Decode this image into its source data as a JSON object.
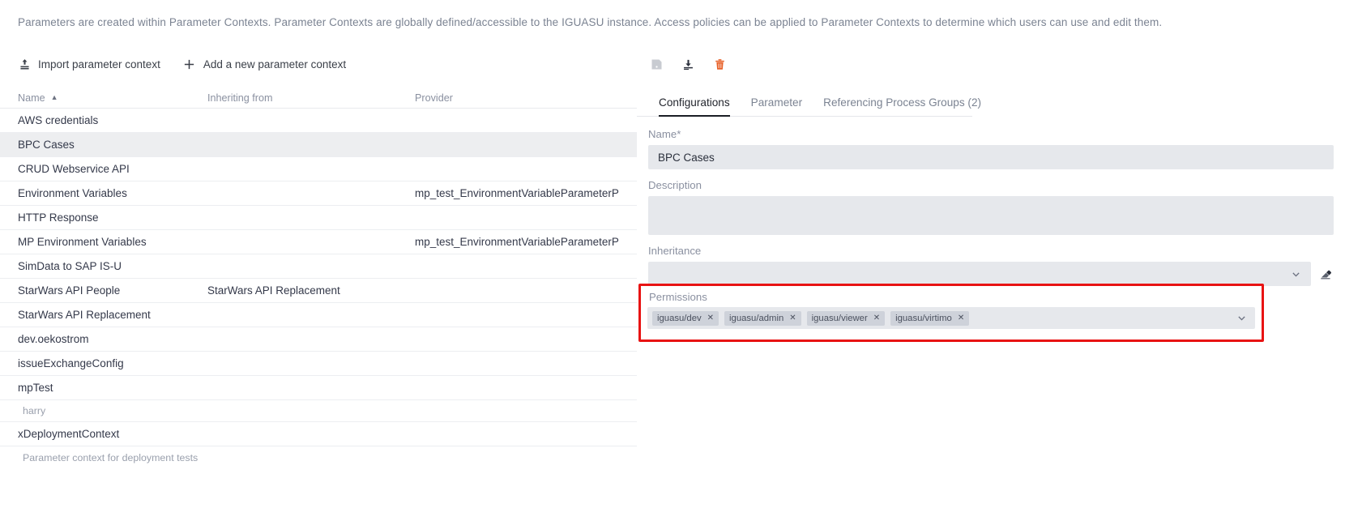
{
  "intro": {
    "text": "Parameters are created within Parameter Contexts. Parameter Contexts are globally defined/accessible to the IGUASU instance. Access policies can be applied to Parameter Contexts to determine which users can use and edit them."
  },
  "actions": {
    "import_label": "Import parameter context",
    "import_icon": "upload-icon",
    "add_label": "Add a new parameter context",
    "add_icon": "plus-icon"
  },
  "table": {
    "columns": [
      "Name",
      "Inheriting from",
      "Provider"
    ],
    "sort_column": "Name",
    "sort_direction": "asc",
    "rows": [
      {
        "name": "AWS credentials",
        "inheriting_from": "",
        "provider": "",
        "selected": false,
        "description": ""
      },
      {
        "name": "BPC Cases",
        "inheriting_from": "",
        "provider": "",
        "selected": true,
        "description": ""
      },
      {
        "name": "CRUD Webservice API",
        "inheriting_from": "",
        "provider": "",
        "selected": false,
        "description": ""
      },
      {
        "name": "Environment Variables",
        "inheriting_from": "",
        "provider": "mp_test_EnvironmentVariableParameterP",
        "selected": false,
        "description": ""
      },
      {
        "name": "HTTP Response",
        "inheriting_from": "",
        "provider": "",
        "selected": false,
        "description": ""
      },
      {
        "name": "MP Environment Variables",
        "inheriting_from": "",
        "provider": "mp_test_EnvironmentVariableParameterP",
        "selected": false,
        "description": ""
      },
      {
        "name": "SimData to SAP IS-U",
        "inheriting_from": "",
        "provider": "",
        "selected": false,
        "description": ""
      },
      {
        "name": "StarWars API People",
        "inheriting_from": "StarWars API Replacement",
        "provider": "",
        "selected": false,
        "description": ""
      },
      {
        "name": "StarWars API Replacement",
        "inheriting_from": "",
        "provider": "",
        "selected": false,
        "description": ""
      },
      {
        "name": "dev.oekostrom",
        "inheriting_from": "",
        "provider": "",
        "selected": false,
        "description": ""
      },
      {
        "name": "issueExchangeConfig",
        "inheriting_from": "",
        "provider": "",
        "selected": false,
        "description": ""
      },
      {
        "name": "mpTest",
        "inheriting_from": "",
        "provider": "",
        "selected": false,
        "description": "harry"
      },
      {
        "name": "xDeploymentContext",
        "inheriting_from": "",
        "provider": "",
        "selected": false,
        "description": "Parameter context for deployment tests"
      }
    ]
  },
  "detail": {
    "toolbar": [
      {
        "name": "save-icon",
        "title": "Save",
        "state": "disabled",
        "color": "#c8cbd1"
      },
      {
        "name": "download-icon",
        "title": "Download",
        "state": "enabled",
        "color": "#2b303c"
      },
      {
        "name": "delete-icon",
        "title": "Delete",
        "state": "enabled",
        "color": "#e8622a"
      }
    ],
    "tabs": [
      {
        "label": "Configurations",
        "active": true
      },
      {
        "label": "Parameter",
        "active": false
      },
      {
        "label": "Referencing Process Groups (2)",
        "active": false
      }
    ],
    "name_label": "Name",
    "name_required_mark": "*",
    "name_value": "BPC Cases",
    "description_label": "Description",
    "description_value": "",
    "inheritance_label": "Inheritance",
    "inheritance_value": "",
    "inheritance_clear_icon": "eraser-icon",
    "permissions_label": "Permissions",
    "permissions_chips": [
      "iguasu/dev",
      "iguasu/admin",
      "iguasu/viewer",
      "iguasu/virtimo"
    ],
    "chip_remove_glyph": "✕",
    "highlight_color": "#e81313"
  }
}
